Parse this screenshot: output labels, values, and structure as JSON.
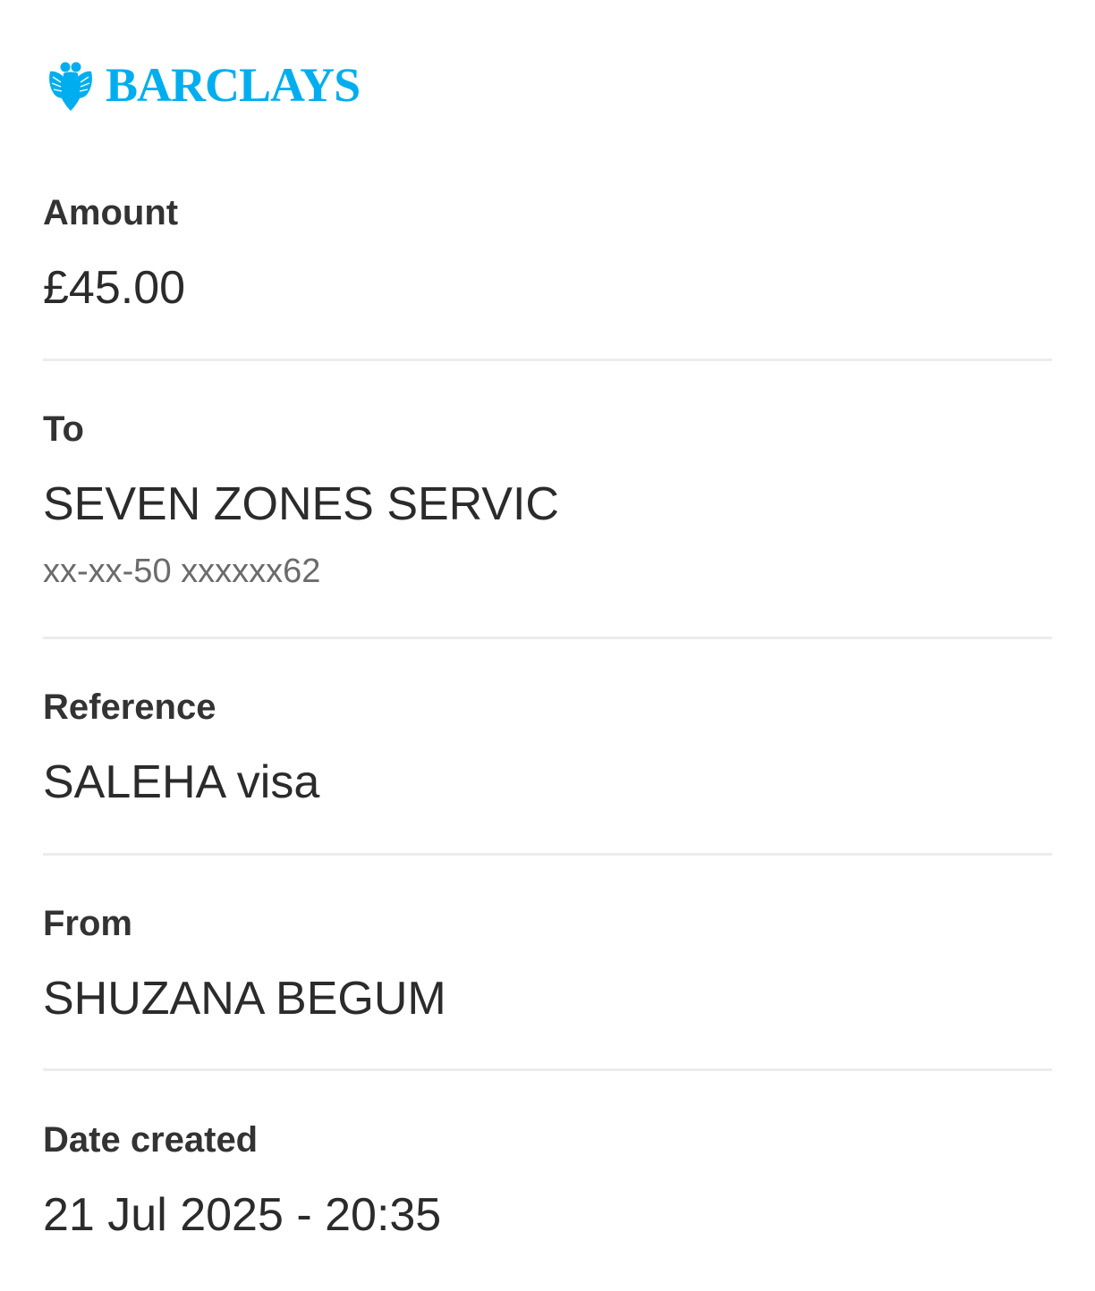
{
  "brand": {
    "name": "BARCLAYS",
    "color": "#00AEEF",
    "icon": "eagle-icon"
  },
  "fields": {
    "amount": {
      "label": "Amount",
      "value": "£45.00"
    },
    "to": {
      "label": "To",
      "value": "SEVEN ZONES SERVIC",
      "account": "xx-xx-50 xxxxxx62"
    },
    "reference": {
      "label": "Reference",
      "value": "SALEHA visa"
    },
    "from": {
      "label": "From",
      "value": "SHUZANA BEGUM"
    },
    "date_created": {
      "label": "Date created",
      "value": "21 Jul 2025 - 20:35"
    }
  },
  "colors": {
    "label": "#333333",
    "value": "#2b2b2b",
    "subvalue": "#6b6b6b",
    "divider": "#ececec"
  }
}
